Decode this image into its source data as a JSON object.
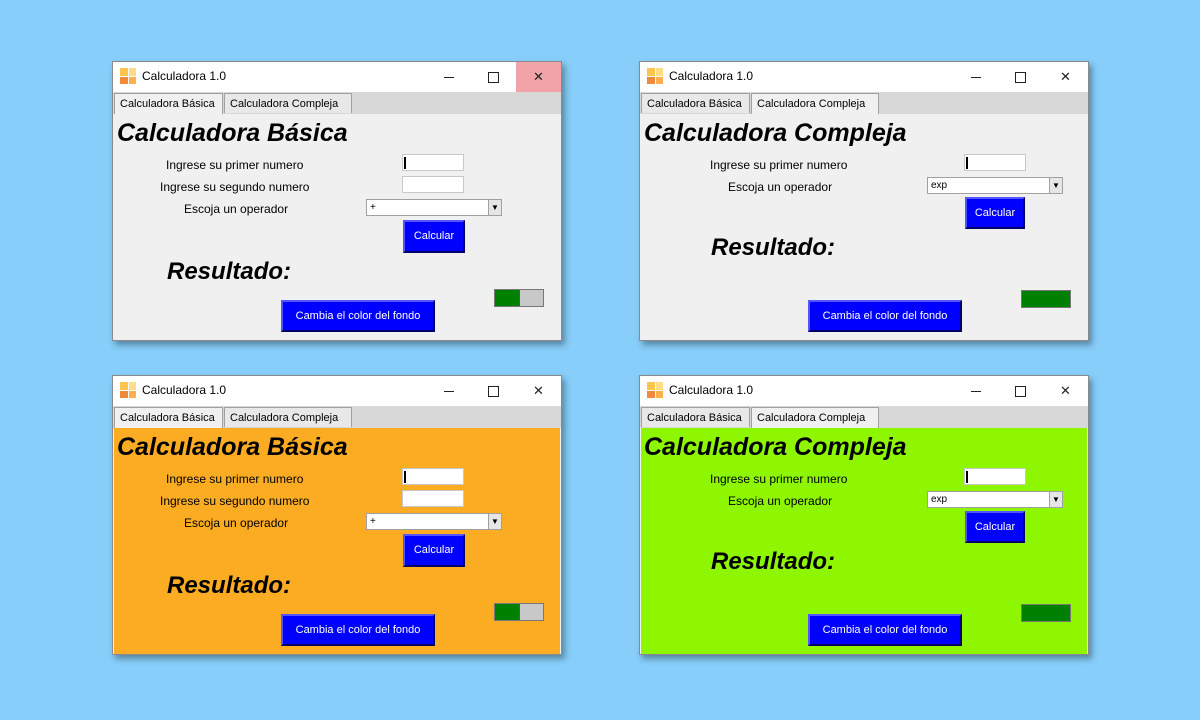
{
  "colors": {
    "desktop": "#87cefa",
    "button": "#0000ff",
    "toggle_on": "#008000",
    "orange_bg": "#fbac22",
    "lime_bg": "#8df600"
  },
  "window": {
    "title": "Calculadora 1.0",
    "icon": "calculator-app-icon",
    "tabs": [
      "Calculadora Básica",
      "Calculadora Compleja"
    ]
  },
  "basic": {
    "heading": "Calculadora Básica",
    "label_first": "Ingrese su primer numero",
    "label_second": "Ingrese su segundo numero",
    "label_operator": "Escoja un operador",
    "operator_value": "+",
    "calc_button": "Calcular",
    "result_label": "Resultado:",
    "bg_button": "Cambia el color del fondo"
  },
  "complex": {
    "heading": "Calculadora Compleja",
    "label_first": "Ingrese su primer numero",
    "label_operator": "Escoja un operador",
    "operator_value": "exp",
    "calc_button": "Calcular",
    "result_label": "Resultado:",
    "bg_button": "Cambia el color del fondo"
  },
  "windows": [
    {
      "active_tab": "Calculadora Básica",
      "background": "gray",
      "close_hovered": true,
      "toggle_state": "half"
    },
    {
      "active_tab": "Calculadora Compleja",
      "background": "gray",
      "close_hovered": false,
      "toggle_state": "full"
    },
    {
      "active_tab": "Calculadora Básica",
      "background": "orange",
      "close_hovered": false,
      "toggle_state": "half"
    },
    {
      "active_tab": "Calculadora Compleja",
      "background": "lime",
      "close_hovered": false,
      "toggle_state": "full"
    }
  ]
}
